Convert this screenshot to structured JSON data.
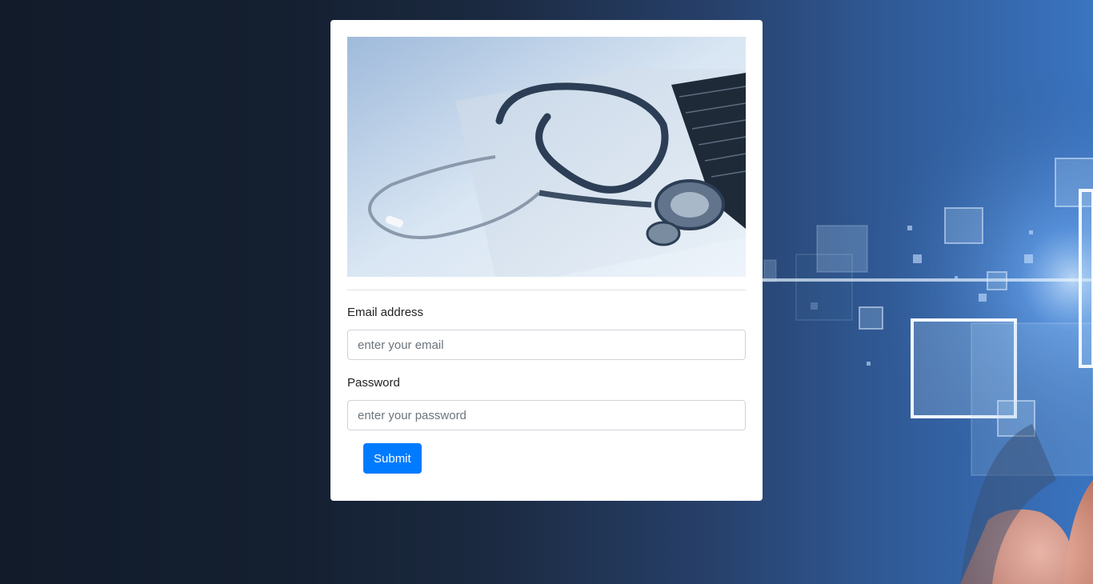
{
  "login_card": {
    "hero_image": "stethoscope-on-laptop",
    "email": {
      "label": "Email address",
      "value": "",
      "placeholder": "enter your email"
    },
    "password": {
      "label": "Password",
      "value": "",
      "placeholder": "enter your password"
    },
    "submit_label": "Submit"
  },
  "background": {
    "image": "digital-technology-squares-with-hand",
    "colors": {
      "dark": "#111b2a",
      "accent": "#3a74c0"
    }
  },
  "colors": {
    "primary_button": "#007bff",
    "card": "#ffffff"
  }
}
